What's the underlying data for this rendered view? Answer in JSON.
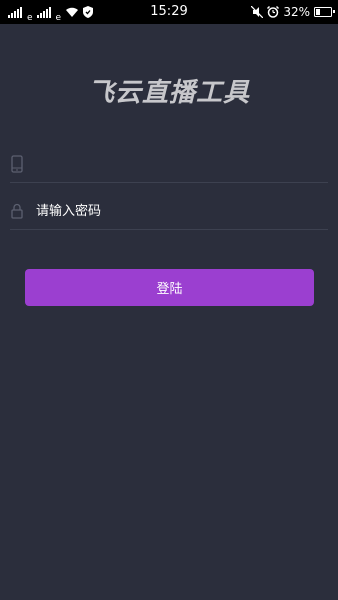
{
  "status_bar": {
    "network_1": "4G",
    "network_2": "4G",
    "time": "15:29",
    "battery_percent": "32%",
    "battery_level": 0.32
  },
  "app": {
    "title": "飞云直播工具"
  },
  "login_form": {
    "phone_placeholder": "",
    "password_placeholder": "请输入密码",
    "login_label": "登陆"
  },
  "colors": {
    "background": "#2b2e3c",
    "accent": "#9b3fd0",
    "divider": "#3d4150"
  }
}
